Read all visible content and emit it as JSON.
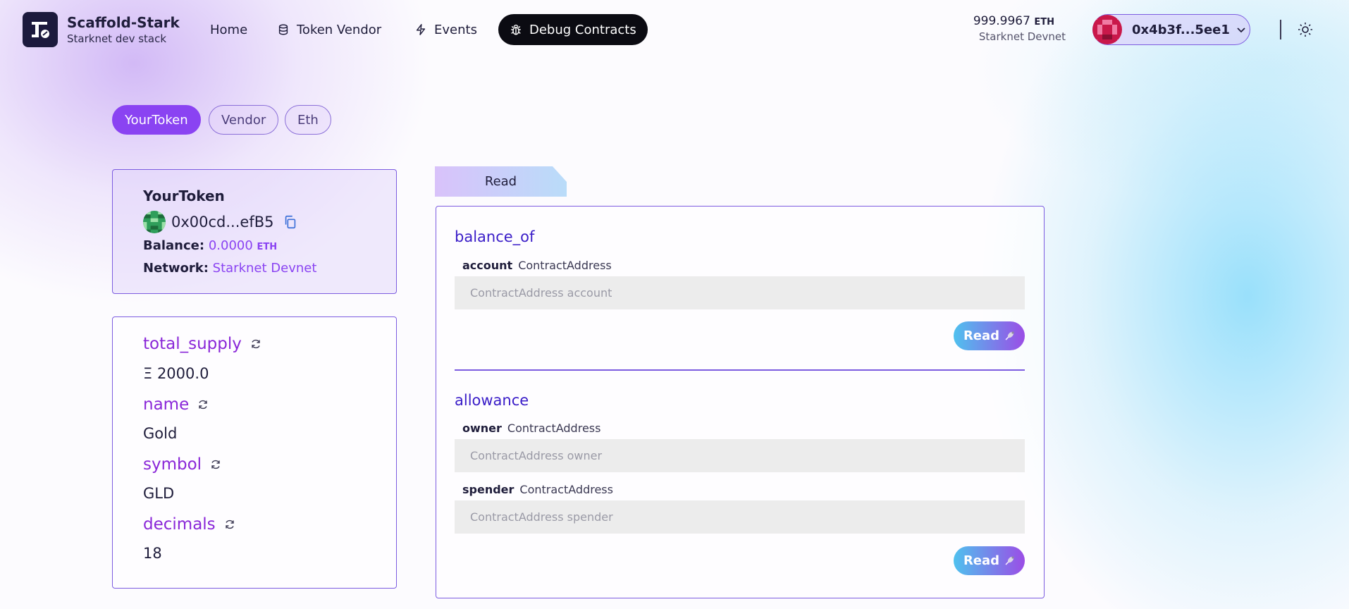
{
  "brand": {
    "title": "Scaffold-Stark",
    "subtitle": "Starknet dev stack"
  },
  "nav": [
    {
      "label": "Home",
      "icon": "none"
    },
    {
      "label": "Token Vendor",
      "icon": "coins-icon"
    },
    {
      "label": "Events",
      "icon": "bolt-icon"
    },
    {
      "label": "Debug Contracts",
      "icon": "bug-icon",
      "active": true
    }
  ],
  "wallet": {
    "balance": "999.9967",
    "unit": "ETH",
    "network": "Starknet Devnet",
    "address": "0x4b3f...5ee1"
  },
  "contract_tabs": [
    {
      "label": "YourToken",
      "active": true
    },
    {
      "label": "Vendor",
      "active": false
    },
    {
      "label": "Eth",
      "active": false
    }
  ],
  "contract_info": {
    "name": "YourToken",
    "address": "0x00cd...efB5",
    "balance_label": "Balance:",
    "balance_value": "0.0000",
    "balance_unit": "ETH",
    "network_label": "Network:",
    "network_value": "Starknet Devnet"
  },
  "variables": [
    {
      "name": "total_supply",
      "value": "Ξ 2000.0"
    },
    {
      "name": "name",
      "value": "Gold"
    },
    {
      "name": "symbol",
      "value": "GLD"
    },
    {
      "name": "decimals",
      "value": "18"
    }
  ],
  "read_panel": {
    "tab_label": "Read",
    "functions": [
      {
        "name": "balance_of",
        "params": [
          {
            "name": "account",
            "type": "ContractAddress",
            "placeholder": "ContractAddress account"
          }
        ],
        "button": "Read"
      },
      {
        "name": "allowance",
        "params": [
          {
            "name": "owner",
            "type": "ContractAddress",
            "placeholder": "ContractAddress owner"
          },
          {
            "name": "spender",
            "type": "ContractAddress",
            "placeholder": "ContractAddress spender"
          }
        ],
        "button": "Read"
      }
    ]
  },
  "colors": {
    "accent": "#8a43f2",
    "border": "#7c5ce0",
    "function_name": "#3a1dc8",
    "nav_active_bg": "#0b0b12"
  }
}
